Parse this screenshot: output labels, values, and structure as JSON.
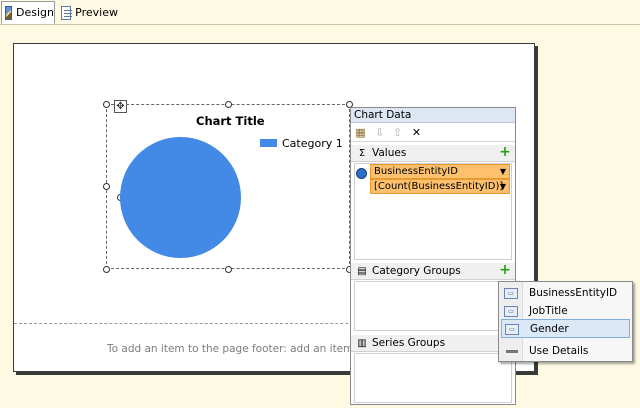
{
  "tabs": [
    {
      "label": "Design",
      "active": true
    },
    {
      "label": "Preview",
      "active": false
    }
  ],
  "report": {
    "footer_hint": "To add an item to the page footer: add an item to the report"
  },
  "chart": {
    "title": "Chart Title",
    "legend_label": "Category 1",
    "series_color": "#4389e6"
  },
  "chart_data_pane": {
    "header": "Chart Data",
    "values_label": "Values",
    "value_field": "BusinessEntityID",
    "value_expression": "[Count(BusinessEntityID)]",
    "category_groups_label": "Category Groups",
    "series_groups_label": "Series Groups"
  },
  "context_menu": {
    "items": [
      {
        "label": "BusinessEntityID",
        "icon": "field-icon"
      },
      {
        "label": "JobTitle",
        "icon": "field-icon"
      },
      {
        "label": "Gender",
        "icon": "field-icon",
        "highlighted": true
      },
      {
        "label": "Use Details",
        "icon": "details-icon"
      }
    ]
  },
  "colors": {
    "tab_bg": "#fdf9e3",
    "value_row": "#fdc06d",
    "pane_header": "#dde6f3",
    "menu_highlight": "#dbe8f8"
  }
}
